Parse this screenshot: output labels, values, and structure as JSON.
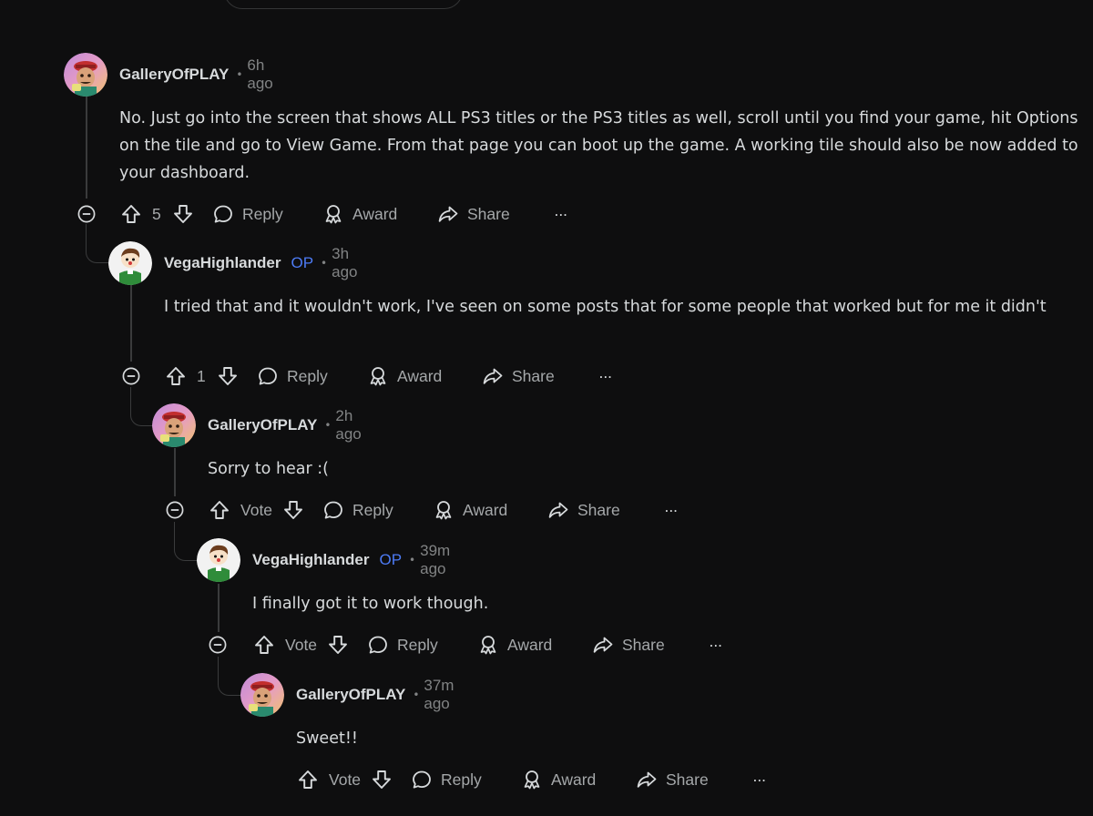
{
  "comments": [
    {
      "author": "GalleryOfPLAY",
      "op_badge": "",
      "time": "6h ago",
      "body": "No. Just go into the screen that shows ALL PS3 titles or the PS3 titles as well, scroll until you find your game, hit Options on the tile and go to View Game. From that page you can boot up the game. A working tile should also be now added to your dashboard.",
      "score": "5",
      "avatar": "gallery-avatar"
    },
    {
      "author": "VegaHighlander",
      "op_badge": "OP",
      "time": "3h ago",
      "body": "I tried that and it wouldn't work, I've seen on some posts that for some people that worked but for me it didn't",
      "score": "1",
      "avatar": "vega-avatar"
    },
    {
      "author": "GalleryOfPLAY",
      "op_badge": "",
      "time": "2h ago",
      "body": "Sorry to hear :(",
      "score": "Vote",
      "avatar": "gallery-avatar"
    },
    {
      "author": "VegaHighlander",
      "op_badge": "OP",
      "time": "39m ago",
      "body": "I finally got it to work though.",
      "score": "Vote",
      "avatar": "vega-avatar"
    },
    {
      "author": "GalleryOfPLAY",
      "op_badge": "",
      "time": "37m ago",
      "body": "Sweet!!",
      "score": "Vote",
      "avatar": "gallery-avatar"
    }
  ],
  "actions": {
    "reply": "Reply",
    "award": "Award",
    "share": "Share",
    "more": "···"
  },
  "colors": {
    "background": "#0e0e0f",
    "text": "#d7dadc",
    "muted": "#818384",
    "op_badge": "#4d7bf5",
    "thread_line": "#3a3b3c"
  }
}
